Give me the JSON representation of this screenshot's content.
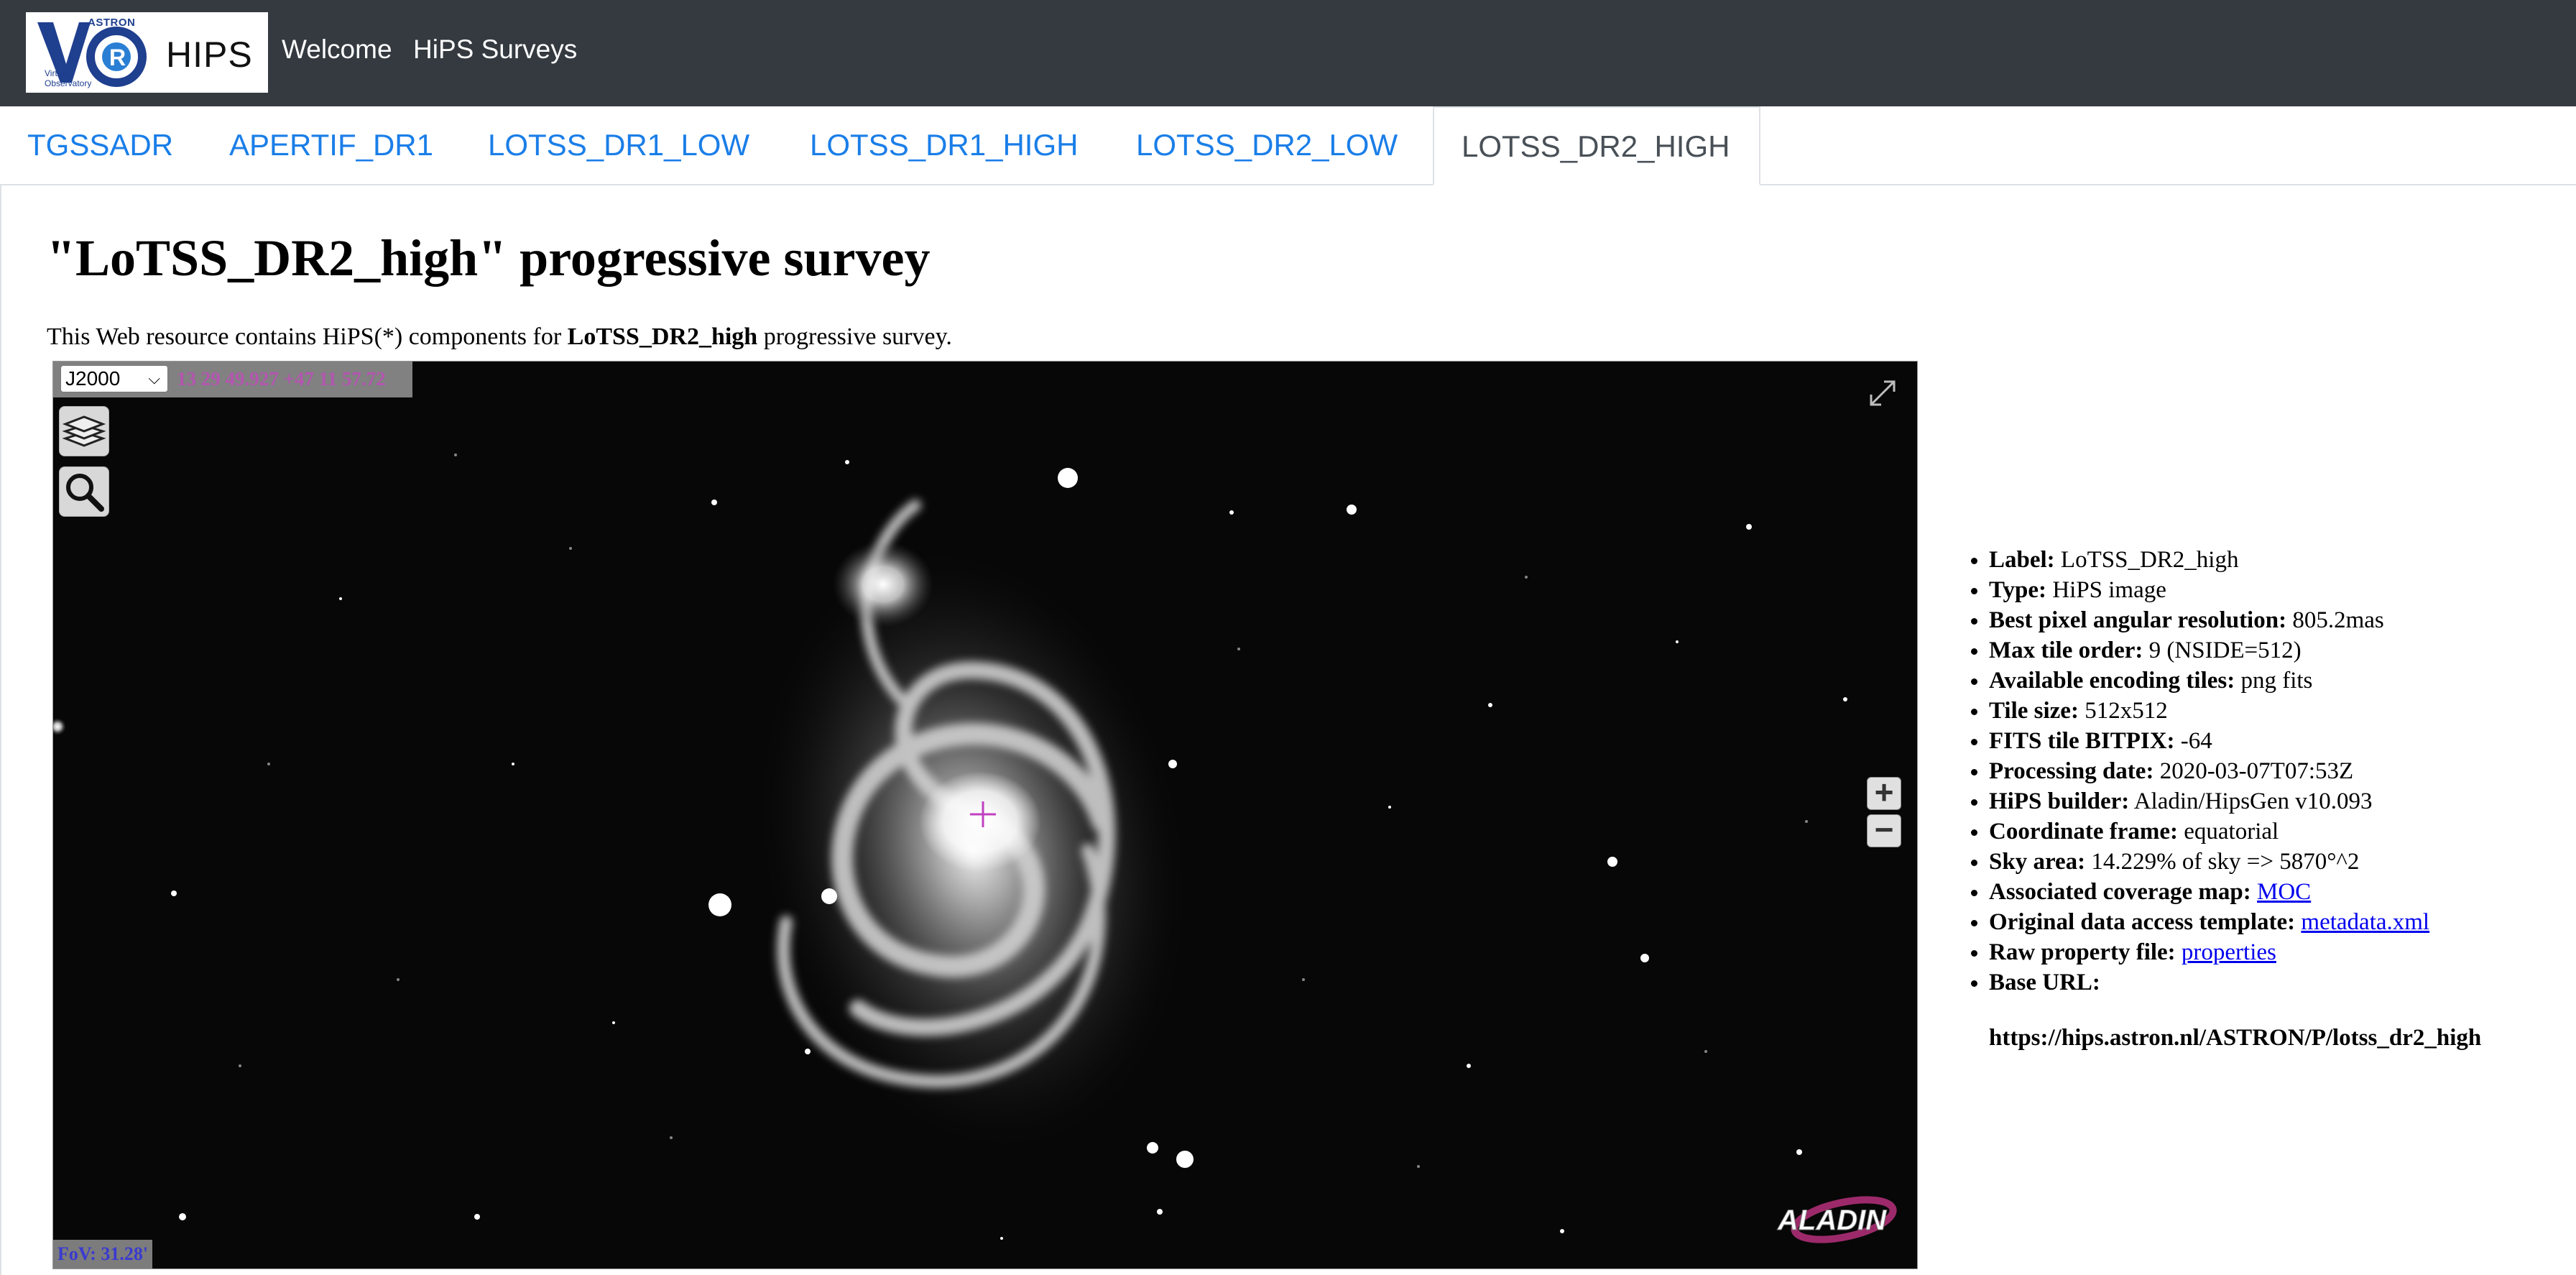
{
  "navbar": {
    "logo_astron": "ASTRON",
    "logo_virtual": "Virtual",
    "logo_observatory": "Observatory",
    "logo_hips": "HIPS",
    "links": [
      "Welcome",
      "HiPS Surveys"
    ]
  },
  "tabs": [
    {
      "label": "TGSSADR",
      "active": false
    },
    {
      "label": "APERTIF_DR1",
      "active": false
    },
    {
      "label": "LOTSS_DR1_LOW",
      "active": false
    },
    {
      "label": "LOTSS_DR1_HIGH",
      "active": false
    },
    {
      "label": "LOTSS_DR2_LOW",
      "active": false
    },
    {
      "label": "LOTSS_DR2_HIGH",
      "active": true
    }
  ],
  "page": {
    "title": "\"LoTSS_DR2_high\" progressive survey",
    "intro_prefix": "This Web resource contains HiPS(*) components for ",
    "intro_bold": "LoTSS_DR2_high",
    "intro_suffix": " progressive survey."
  },
  "viewer": {
    "frame_selected": "J2000",
    "coordinates": "13 29 49.927 +47 11 57.72",
    "fov": "FoV: 31.28'",
    "zoom_in": "+",
    "zoom_out": "−",
    "logo_text": "ALADIN",
    "crosshair_color": "#c040c0"
  },
  "properties": {
    "label": {
      "key": "Label:",
      "value": "LoTSS_DR2_high"
    },
    "type": {
      "key": "Type:",
      "value": "HiPS image"
    },
    "resolution": {
      "key": "Best pixel angular resolution:",
      "value": "805.2mas"
    },
    "max_order": {
      "key": "Max tile order:",
      "value": "9 (NSIDE=512)"
    },
    "encoding": {
      "key": "Available encoding tiles:",
      "value": "png fits"
    },
    "tile_size": {
      "key": "Tile size:",
      "value": "512x512"
    },
    "bitpix": {
      "key": "FITS tile BITPIX:",
      "value": "-64"
    },
    "processing_date": {
      "key": "Processing date:",
      "value": "2020-03-07T07:53Z"
    },
    "builder": {
      "key": "HiPS builder:",
      "value": "Aladin/HipsGen v10.093"
    },
    "frame": {
      "key": "Coordinate frame:",
      "value": "equatorial"
    },
    "sky_area": {
      "key": "Sky area:",
      "value": "14.229% of sky => 5870°^2"
    },
    "moc": {
      "key": "Associated coverage map:",
      "link": "MOC"
    },
    "template": {
      "key": "Original data access template:",
      "link": "metadata.xml"
    },
    "raw": {
      "key": "Raw property file:",
      "link": "properties"
    },
    "base_url": {
      "key": "Base URL:",
      "value": "https://hips.astron.nl/ASTRON/P/lotss_dr2_high"
    }
  },
  "colors": {
    "navbar_bg": "#343a40",
    "tab_link": "#1a7ee8",
    "tab_active": "#495057",
    "coords_text": "#b455b0",
    "fov_text": "#3a3ad0"
  }
}
